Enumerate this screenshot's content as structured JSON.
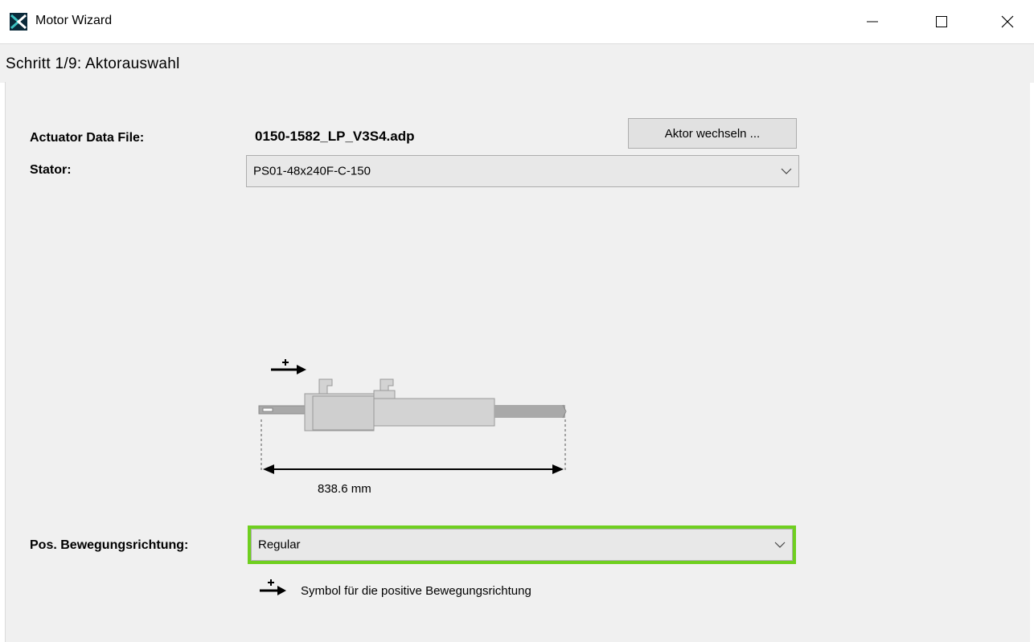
{
  "window": {
    "title": "Motor Wizard",
    "icon": "app-logo-icon",
    "controls": [
      "minimize-icon",
      "maximize-icon",
      "close-icon"
    ]
  },
  "step": {
    "title": "Schritt 1/9: Aktorauswahl"
  },
  "form": {
    "actuator_label": "Actuator Data File:",
    "actuator_value": "0150-1582_LP_V3S4.adp",
    "change_button": "Aktor wechseln ...",
    "stator_label": "Stator:",
    "stator_value": "PS01-48x240F-C-150",
    "direction_label": "Pos. Bewegungsrichtung:",
    "direction_value": "Regular",
    "direction_hint": "Symbol für die positive Bewegungsrichtung"
  },
  "diagram": {
    "length_label": "838.6 mm"
  },
  "colors": {
    "highlight": "#6fcf1f",
    "panel_bg": "#f0f0f0",
    "actuator_body": "#d3d3d3"
  }
}
